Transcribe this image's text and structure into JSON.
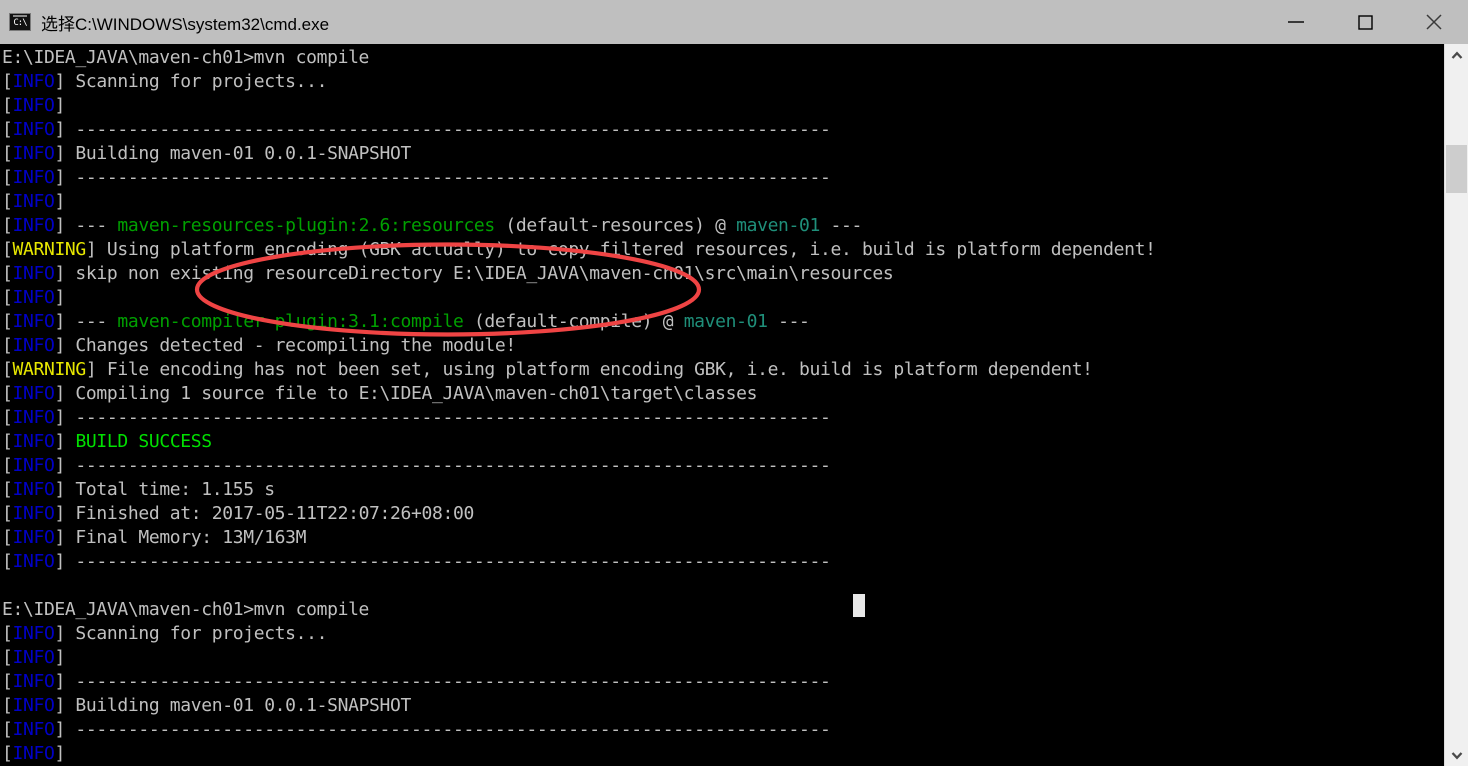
{
  "window": {
    "title": "选择C:\\WINDOWS\\system32\\cmd.exe",
    "icon": "cmd-icon",
    "icon_text": "C:\\",
    "titlebar_bg": "#bfbfbf",
    "controls": {
      "minimize": "minimize-button",
      "maximize": "maximize-button",
      "close": "close-button"
    }
  },
  "colors": {
    "background": "#000000",
    "default_text": "#c0c0c0",
    "info": "#0000c8",
    "warning": "#e8e800",
    "plugin": "#00a000",
    "success": "#00e000",
    "artifact": "#1f8f7a",
    "annotation": "#ef4444"
  },
  "annotation": {
    "shape": "ellipse",
    "color": "#ef4444",
    "stroke_width": 4
  },
  "scrollbar": {
    "up_arrow": "scroll-up-arrow",
    "down_arrow": "scroll-down-arrow",
    "thumb": "scrollbar-thumb"
  },
  "terminal": {
    "cursor_visible": true,
    "prompt": "E:\\IDEA_JAVA\\maven-ch01>",
    "command": "mvn compile",
    "lines": [
      {
        "id": "l01",
        "segments": [
          {
            "t": "E:\\IDEA_JAVA\\maven-ch01>mvn compile",
            "c": "c-white"
          }
        ]
      },
      {
        "id": "l02",
        "segments": [
          {
            "t": "[",
            "c": "c-bracket"
          },
          {
            "t": "INFO",
            "c": "c-blue"
          },
          {
            "t": "] Scanning for projects...",
            "c": "c-white"
          }
        ]
      },
      {
        "id": "l03",
        "segments": [
          {
            "t": "[",
            "c": "c-bracket"
          },
          {
            "t": "INFO",
            "c": "c-blue"
          },
          {
            "t": "] ",
            "c": "c-white"
          }
        ]
      },
      {
        "id": "l04",
        "segments": [
          {
            "t": "[",
            "c": "c-bracket"
          },
          {
            "t": "INFO",
            "c": "c-blue"
          },
          {
            "t": "] ------------------------------------------------------------------------",
            "c": "c-white"
          }
        ]
      },
      {
        "id": "l05",
        "segments": [
          {
            "t": "[",
            "c": "c-bracket"
          },
          {
            "t": "INFO",
            "c": "c-blue"
          },
          {
            "t": "] Building maven-01 0.0.1-SNAPSHOT",
            "c": "c-white"
          }
        ]
      },
      {
        "id": "l06",
        "segments": [
          {
            "t": "[",
            "c": "c-bracket"
          },
          {
            "t": "INFO",
            "c": "c-blue"
          },
          {
            "t": "] ------------------------------------------------------------------------",
            "c": "c-white"
          }
        ]
      },
      {
        "id": "l07",
        "segments": [
          {
            "t": "[",
            "c": "c-bracket"
          },
          {
            "t": "INFO",
            "c": "c-blue"
          },
          {
            "t": "] ",
            "c": "c-white"
          }
        ]
      },
      {
        "id": "l08",
        "segments": [
          {
            "t": "[",
            "c": "c-bracket"
          },
          {
            "t": "INFO",
            "c": "c-blue"
          },
          {
            "t": "] --- ",
            "c": "c-white"
          },
          {
            "t": "maven-resources-plugin:2.6:resources",
            "c": "c-green"
          },
          {
            "t": " (default-resources) @ ",
            "c": "c-white"
          },
          {
            "t": "maven-01",
            "c": "c-teal"
          },
          {
            "t": " ---",
            "c": "c-white"
          }
        ]
      },
      {
        "id": "l09",
        "segments": [
          {
            "t": "[",
            "c": "c-bracket"
          },
          {
            "t": "WARNING",
            "c": "c-yellow"
          },
          {
            "t": "] Using platform encoding (GBK actually) to copy filtered resources, i.e. build is platform dependent!",
            "c": "c-white"
          }
        ]
      },
      {
        "id": "l10",
        "segments": [
          {
            "t": "[",
            "c": "c-bracket"
          },
          {
            "t": "INFO",
            "c": "c-blue"
          },
          {
            "t": "] skip non existing resourceDirectory E:\\IDEA_JAVA\\maven-ch01\\src\\main\\resources",
            "c": "c-white"
          }
        ]
      },
      {
        "id": "l11",
        "segments": [
          {
            "t": "[",
            "c": "c-bracket"
          },
          {
            "t": "INFO",
            "c": "c-blue"
          },
          {
            "t": "] ",
            "c": "c-white"
          }
        ]
      },
      {
        "id": "l12",
        "segments": [
          {
            "t": "[",
            "c": "c-bracket"
          },
          {
            "t": "INFO",
            "c": "c-blue"
          },
          {
            "t": "] --- ",
            "c": "c-white"
          },
          {
            "t": "maven-compiler-plugin:3.1:compile",
            "c": "c-green"
          },
          {
            "t": " (default-compile) @ ",
            "c": "c-white"
          },
          {
            "t": "maven-01",
            "c": "c-teal"
          },
          {
            "t": " ---",
            "c": "c-white"
          }
        ]
      },
      {
        "id": "l13",
        "segments": [
          {
            "t": "[",
            "c": "c-bracket"
          },
          {
            "t": "INFO",
            "c": "c-blue"
          },
          {
            "t": "] Changes detected - recompiling the module!",
            "c": "c-white"
          }
        ]
      },
      {
        "id": "l14",
        "segments": [
          {
            "t": "[",
            "c": "c-bracket"
          },
          {
            "t": "WARNING",
            "c": "c-yellow"
          },
          {
            "t": "] File encoding has not been set, using platform encoding GBK, i.e. build is platform dependent!",
            "c": "c-white"
          }
        ]
      },
      {
        "id": "l15",
        "segments": [
          {
            "t": "[",
            "c": "c-bracket"
          },
          {
            "t": "INFO",
            "c": "c-blue"
          },
          {
            "t": "] Compiling 1 source file to E:\\IDEA_JAVA\\maven-ch01\\target\\classes",
            "c": "c-white"
          }
        ]
      },
      {
        "id": "l16",
        "segments": [
          {
            "t": "[",
            "c": "c-bracket"
          },
          {
            "t": "INFO",
            "c": "c-blue"
          },
          {
            "t": "] ------------------------------------------------------------------------",
            "c": "c-white"
          }
        ]
      },
      {
        "id": "l17",
        "segments": [
          {
            "t": "[",
            "c": "c-bracket"
          },
          {
            "t": "INFO",
            "c": "c-blue"
          },
          {
            "t": "] ",
            "c": "c-white"
          },
          {
            "t": "BUILD SUCCESS",
            "c": "c-lime"
          }
        ]
      },
      {
        "id": "l18",
        "segments": [
          {
            "t": "[",
            "c": "c-bracket"
          },
          {
            "t": "INFO",
            "c": "c-blue"
          },
          {
            "t": "] ------------------------------------------------------------------------",
            "c": "c-white"
          }
        ]
      },
      {
        "id": "l19",
        "segments": [
          {
            "t": "[",
            "c": "c-bracket"
          },
          {
            "t": "INFO",
            "c": "c-blue"
          },
          {
            "t": "] Total time: 1.155 s",
            "c": "c-white"
          }
        ]
      },
      {
        "id": "l20",
        "segments": [
          {
            "t": "[",
            "c": "c-bracket"
          },
          {
            "t": "INFO",
            "c": "c-blue"
          },
          {
            "t": "] Finished at: 2017-05-11T22:07:26+08:00",
            "c": "c-white"
          }
        ]
      },
      {
        "id": "l21",
        "segments": [
          {
            "t": "[",
            "c": "c-bracket"
          },
          {
            "t": "INFO",
            "c": "c-blue"
          },
          {
            "t": "] Final Memory: 13M/163M",
            "c": "c-white"
          }
        ]
      },
      {
        "id": "l22",
        "segments": [
          {
            "t": "[",
            "c": "c-bracket"
          },
          {
            "t": "INFO",
            "c": "c-blue"
          },
          {
            "t": "] ------------------------------------------------------------------------",
            "c": "c-white"
          }
        ]
      },
      {
        "id": "l23",
        "segments": [
          {
            "t": "",
            "c": "c-white"
          }
        ]
      },
      {
        "id": "l24",
        "segments": [
          {
            "t": "E:\\IDEA_JAVA\\maven-ch01>mvn compile",
            "c": "c-white"
          }
        ]
      },
      {
        "id": "l25",
        "segments": [
          {
            "t": "[",
            "c": "c-bracket"
          },
          {
            "t": "INFO",
            "c": "c-blue"
          },
          {
            "t": "] Scanning for projects...",
            "c": "c-white"
          }
        ]
      },
      {
        "id": "l26",
        "segments": [
          {
            "t": "[",
            "c": "c-bracket"
          },
          {
            "t": "INFO",
            "c": "c-blue"
          },
          {
            "t": "] ",
            "c": "c-white"
          }
        ]
      },
      {
        "id": "l27",
        "segments": [
          {
            "t": "[",
            "c": "c-bracket"
          },
          {
            "t": "INFO",
            "c": "c-blue"
          },
          {
            "t": "] ------------------------------------------------------------------------",
            "c": "c-white"
          }
        ]
      },
      {
        "id": "l28",
        "segments": [
          {
            "t": "[",
            "c": "c-bracket"
          },
          {
            "t": "INFO",
            "c": "c-blue"
          },
          {
            "t": "] Building maven-01 0.0.1-SNAPSHOT",
            "c": "c-white"
          }
        ]
      },
      {
        "id": "l29",
        "segments": [
          {
            "t": "[",
            "c": "c-bracket"
          },
          {
            "t": "INFO",
            "c": "c-blue"
          },
          {
            "t": "] ------------------------------------------------------------------------",
            "c": "c-white"
          }
        ]
      },
      {
        "id": "l30",
        "segments": [
          {
            "t": "[",
            "c": "c-bracket"
          },
          {
            "t": "INFO",
            "c": "c-blue"
          },
          {
            "t": "]",
            "c": "c-white"
          }
        ]
      }
    ]
  }
}
